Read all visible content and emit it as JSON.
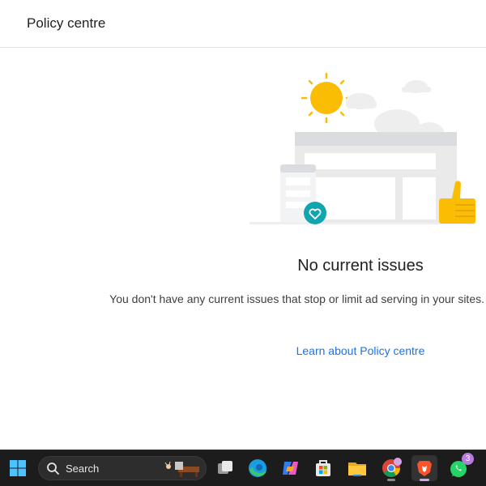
{
  "header": {
    "title": "Policy centre"
  },
  "main": {
    "headline": "No current issues",
    "description": "You don't have any current issues that stop or limit ad serving in your sites.",
    "link_label": "Learn about Policy centre"
  },
  "taskbar": {
    "search_label": "Search",
    "whatsapp_badge": "3",
    "icons": [
      "windows-start-icon",
      "search-icon",
      "task-view-icon",
      "edge-icon",
      "copilot-icon",
      "store-icon",
      "file-explorer-icon",
      "chrome-icon",
      "brave-icon",
      "whatsapp-icon"
    ]
  },
  "colors": {
    "link": "#1a73e8",
    "sun": "#fbbc04",
    "teal": "#12a4af",
    "taskbar": "#1c1c1c"
  }
}
